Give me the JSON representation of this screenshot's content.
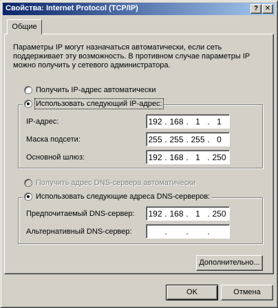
{
  "window": {
    "title": "Свойства: Internet Protocol (TCP/IP)",
    "help_btn": "?",
    "close_btn": "✕"
  },
  "tabs": [
    {
      "label": "Общие"
    }
  ],
  "description": "Параметры IP могут назначаться автоматически, если сеть поддерживает эту возможность. В противном случае параметры IP можно получить у сетевого администратора.",
  "ip_section": {
    "auto_option": "Получить IP-адрес автоматически",
    "manual_option": "Использовать следующий IP-адрес:",
    "fields": [
      {
        "label": "IP-адрес:",
        "octets": [
          "192",
          "168",
          "1",
          "1"
        ]
      },
      {
        "label": "Маска подсети:",
        "octets": [
          "255",
          "255",
          "255",
          "0"
        ]
      },
      {
        "label": "Основной шлюз:",
        "octets": [
          "192",
          "168",
          "1",
          "250"
        ]
      }
    ]
  },
  "dns_section": {
    "auto_option": "Получить адрес DNS-сервера автоматически",
    "manual_option": "Использовать следующие адреса DNS-серверов:",
    "fields": [
      {
        "label": "Предпочитаемый DNS-сервер:",
        "octets": [
          "192",
          "168",
          "1",
          "250"
        ]
      },
      {
        "label": "Альтернативный DNS-сервер:",
        "octets": [
          "",
          "",
          "",
          ""
        ]
      }
    ]
  },
  "buttons": {
    "advanced": "Дополнительно...",
    "ok": "OK",
    "cancel": "Отмена"
  }
}
